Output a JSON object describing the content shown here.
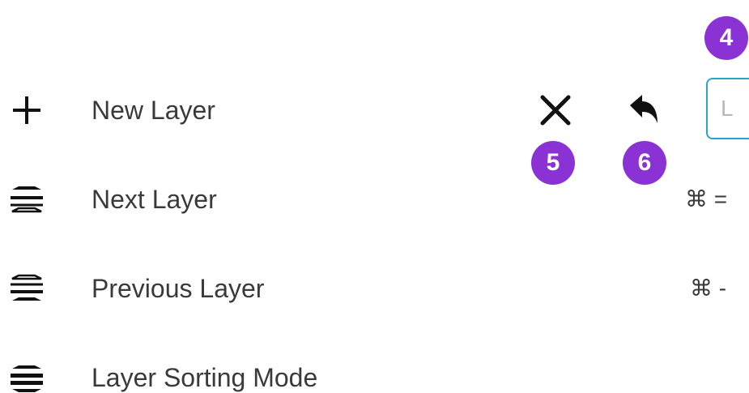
{
  "menu": {
    "items": [
      {
        "label": "New Layer",
        "icon": "plus-icon",
        "shortcut": ""
      },
      {
        "label": "Next Layer",
        "icon": "layers-next-icon",
        "shortcut": "⌘ ="
      },
      {
        "label": "Previous Layer",
        "icon": "layers-previous-icon",
        "shortcut": "⌘ -"
      },
      {
        "label": "Layer Sorting Mode",
        "icon": "layers-sort-icon",
        "shortcut": ""
      }
    ]
  },
  "actions": {
    "close_icon": "close-icon",
    "undo_icon": "undo-arrow-icon",
    "shortcut_key": "L"
  },
  "annotations": {
    "badge_4": "4",
    "badge_5": "5",
    "badge_6": "6",
    "badge_color": "#8b32d4"
  },
  "colors": {
    "text": "#3a3a3a",
    "key_border": "#2aa3c9",
    "key_text": "#b8b8b8"
  }
}
